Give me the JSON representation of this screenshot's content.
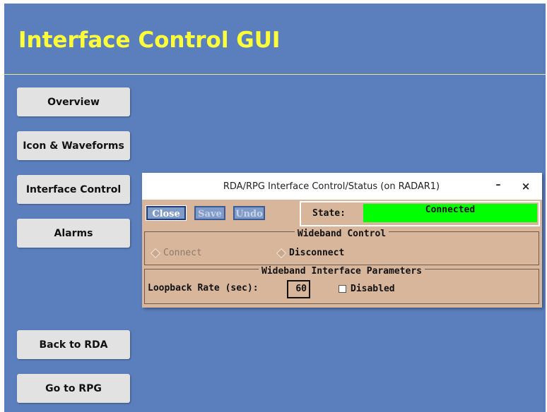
{
  "page": {
    "title": "Interface Control GUI"
  },
  "nav": {
    "overview": "Overview",
    "icon_waveforms": "Icon & Waveforms",
    "interface_control": "Interface Control",
    "alarms": "Alarms",
    "back_to_rda": "Back to RDA",
    "go_to_rpg": "Go to RPG"
  },
  "dialog": {
    "title": "RDA/RPG Interface Control/Status (on RADAR1)",
    "minimize_glyph": "–",
    "close_glyph": "×",
    "toolbar": {
      "close": "Close",
      "save": "Save",
      "undo": "Undo"
    },
    "state": {
      "label": "State:",
      "value": "Connected",
      "value_color": "#00ff00"
    },
    "wideband_control": {
      "title": "Wideband Control",
      "connect": "Connect",
      "disconnect": "Disconnect"
    },
    "wideband_params": {
      "title": "Wideband Interface Parameters",
      "loopback_label": "Loopback Rate (sec):",
      "loopback_value": "60",
      "disabled_label": "Disabled",
      "disabled_checked": false
    }
  },
  "colors": {
    "background": "#5b7fbd",
    "title": "#ffff3a",
    "dialog_bg": "#d7b69c"
  }
}
